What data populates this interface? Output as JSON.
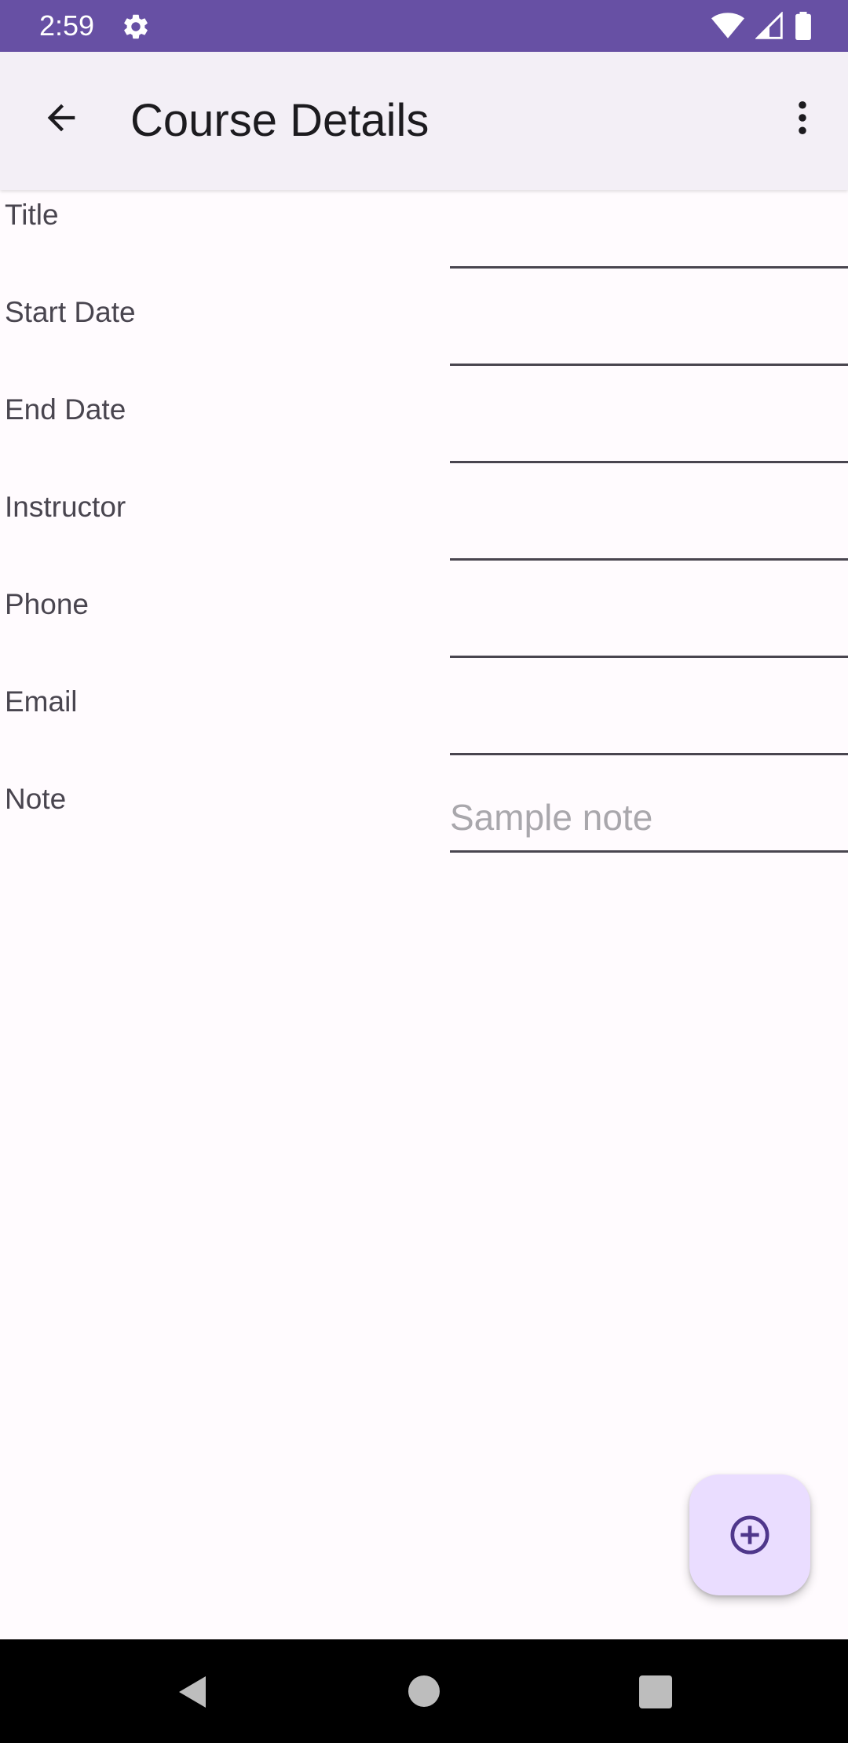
{
  "status_bar": {
    "time": "2:59",
    "background": "#6750a4",
    "icons": [
      "settings-icon",
      "wifi-icon",
      "signal-icon",
      "battery-icon"
    ]
  },
  "app_bar": {
    "title": "Course Details",
    "back_icon": "arrow-back-icon",
    "menu_icon": "more-vert-icon"
  },
  "form": {
    "fields": [
      {
        "label": "Title",
        "value": "",
        "placeholder": ""
      },
      {
        "label": "Start Date",
        "value": "",
        "placeholder": ""
      },
      {
        "label": "End Date",
        "value": "",
        "placeholder": ""
      },
      {
        "label": "Instructor",
        "value": "",
        "placeholder": ""
      },
      {
        "label": "Phone",
        "value": "",
        "placeholder": ""
      },
      {
        "label": "Email",
        "value": "",
        "placeholder": ""
      },
      {
        "label": "Note",
        "value": "",
        "placeholder": "Sample note"
      }
    ]
  },
  "fab": {
    "icon": "add-circle-icon",
    "background": "#eaddff",
    "icon_color": "#4f378b"
  },
  "nav_bar": {
    "icons": [
      "nav-back-icon",
      "nav-home-icon",
      "nav-recents-icon"
    ]
  }
}
